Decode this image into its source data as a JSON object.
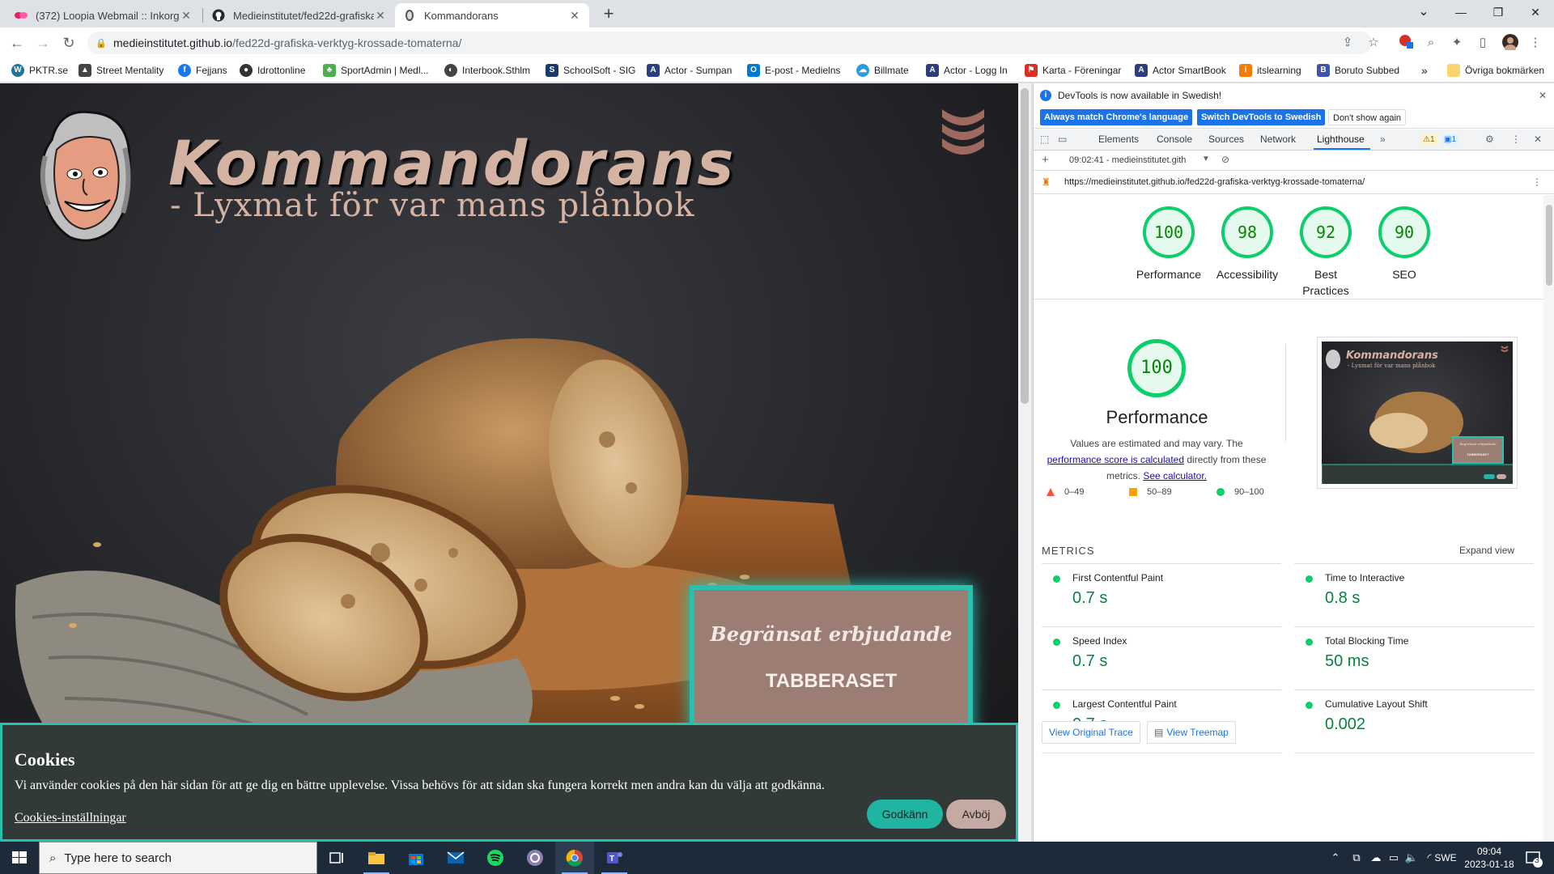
{
  "tabs": [
    {
      "title": "(372) Loopia Webmail :: Inkorg",
      "icon": "loopia-icon"
    },
    {
      "title": "Medieinstitutet/fed22d-grafiska-",
      "icon": "github-icon"
    },
    {
      "title": "Kommandorans",
      "icon": "site-icon",
      "active": true
    }
  ],
  "address": {
    "domain": "medieinstitutet.github.io",
    "path": "/fed22d-grafiska-verktyg-krossade-tomaterna/"
  },
  "bookmarks": [
    "PKTR.se",
    "Street Mentality",
    "Fejjans",
    "Idrottonline",
    "SportAdmin | Medl...",
    "Interbook.Sthlm",
    "SchoolSoft - SIG",
    "Actor - Sumpan",
    "E-post - Medielns",
    "Billmate",
    "Actor - Logg In",
    "Karta - Föreningar",
    "Actor SmartBook",
    "itslearning",
    "Boruto Subbed"
  ],
  "bookmarks_more": "»",
  "bookmarks_other": "Övriga bokmärken",
  "page": {
    "brand": "Kommandorans",
    "tagline": "- Lyxmat för var mans plånbok",
    "offer_title": "Begränsat erbjudande",
    "offer_sub": "TABBERASET",
    "cookies": {
      "title": "Cookies",
      "text": "Vi använder cookies på den här sidan för att ge dig en bättre upplevelse. Vissa behövs för att sidan ska fungera korrekt men andra kan du välja att godkänna.",
      "settings": "Cookies-inställningar",
      "accept": "Godkänn",
      "reject": "Avböj"
    }
  },
  "devtools": {
    "info": "DevTools is now available in Swedish!",
    "btn_match": "Always match Chrome's language",
    "btn_switch": "Switch DevTools to Swedish",
    "btn_dont": "Don't show again",
    "tabs": [
      "Elements",
      "Console",
      "Sources",
      "Network",
      "Lighthouse"
    ],
    "more_tabs": "»",
    "warn_count": "1",
    "msg_count": "1",
    "report_label": "09:02:41 - medieinstitutet.gith",
    "report_url": "https://medieinstitutet.github.io/fed22d-grafiska-verktyg-krossade-tomaterna/"
  },
  "lighthouse": {
    "scores": [
      {
        "value": "100",
        "label": "Performance"
      },
      {
        "value": "98",
        "label": "Accessibility"
      },
      {
        "value": "92",
        "label": "Best Practices"
      },
      {
        "value": "90",
        "label": "SEO"
      }
    ],
    "perf_score": "100",
    "perf_title": "Performance",
    "desc_1": "Values are estimated and may vary. The",
    "desc_link": "performance score is calculated",
    "desc_2": "directly from these metrics.",
    "desc_calc": "See calculator.",
    "legend": [
      "0–49",
      "50–89",
      "90–100"
    ],
    "metrics_heading": "METRICS",
    "expand": "Expand view",
    "metrics": [
      {
        "name": "First Contentful Paint",
        "value": "0.7 s"
      },
      {
        "name": "Time to Interactive",
        "value": "0.8 s"
      },
      {
        "name": "Speed Index",
        "value": "0.7 s"
      },
      {
        "name": "Total Blocking Time",
        "value": "50 ms"
      },
      {
        "name": "Largest Contentful Paint",
        "value": "0.7 s"
      },
      {
        "name": "Cumulative Layout Shift",
        "value": "0.002"
      }
    ],
    "thumb_brand": "Kommandorans",
    "thumb_tagline": "- Lyxmat för var mans plånbok",
    "thumb_offer": "Begränsat erbjudande",
    "thumb_sub": "TABBERASET",
    "view_trace": "View Original Trace",
    "view_treemap": "View Treemap"
  },
  "taskbar": {
    "search": "Type here to search",
    "lang": "SWE",
    "time": "09:04",
    "date": "2023-01-18",
    "notif": "3"
  }
}
